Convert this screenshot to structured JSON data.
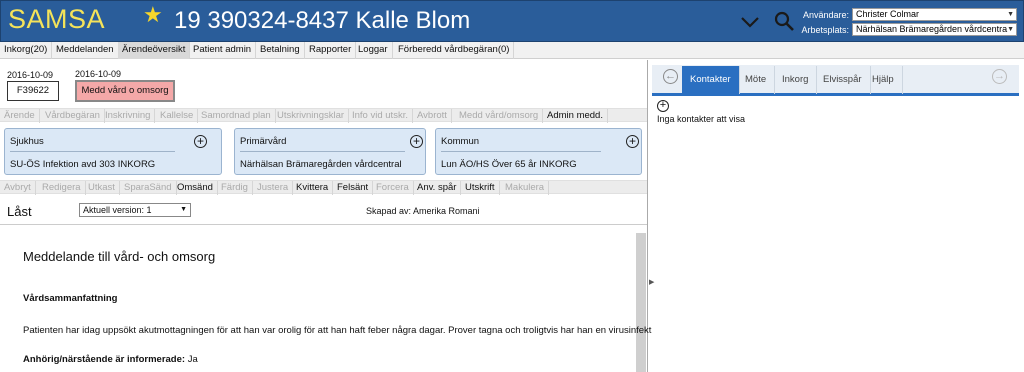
{
  "header": {
    "logo": "SAMSA",
    "patient": "19 390324-8437 Kalle Blom",
    "user_label": "Användare:",
    "user_value": "Christer Colmar",
    "workplace_label": "Arbetsplats:",
    "workplace_value": "Närhälsan Brämaregården vårdcentra",
    "colors": {
      "bar": "#2a5d9a",
      "logo": "#f4e35a",
      "star": "#f6d62a"
    },
    "icons": [
      "star-icon",
      "chevron-down-icon",
      "search-icon"
    ]
  },
  "menu": [
    "Inkorg(20)",
    "Meddelanden",
    "Ärendeöversikt",
    "Patient admin",
    "Betalning",
    "Rapporter",
    "Loggar",
    "Förberedd vårdbegäran(0)"
  ],
  "menu_active": "Ärendeöversikt",
  "case": {
    "date1": "2016-10-09",
    "date2": "2016-10-09",
    "id": "F39622",
    "status": "Medd vård o omsorg",
    "status_color": "#f4a8a8"
  },
  "toolbar1": [
    {
      "label": "Ärende",
      "enabled": false
    },
    {
      "label": "Vårdbegäran",
      "enabled": false
    },
    {
      "label": "Inskrivning",
      "enabled": false
    },
    {
      "label": "Kallelse",
      "enabled": false
    },
    {
      "label": "Samordnad plan",
      "enabled": false
    },
    {
      "label": "Utskrivningsklar",
      "enabled": false
    },
    {
      "label": "Info vid utskr.",
      "enabled": false
    },
    {
      "label": "Avbrott",
      "enabled": false
    },
    {
      "label": "Medd vård/omsorg",
      "enabled": false
    },
    {
      "label": "Admin medd.",
      "enabled": true
    }
  ],
  "cards": [
    {
      "title": "Sjukhus",
      "value": "SU-ÖS Infektion avd 303 INKORG"
    },
    {
      "title": "Primärvård",
      "value": "Närhälsan Brämaregården vårdcentral"
    },
    {
      "title": "Kommun",
      "value": "Lun ÄO/HS Över 65 år INKORG"
    }
  ],
  "toolbar2": [
    {
      "label": "Avbryt",
      "enabled": false
    },
    {
      "label": "Redigera",
      "enabled": false
    },
    {
      "label": "Utkast",
      "enabled": false
    },
    {
      "label": "SparaSänd",
      "enabled": false
    },
    {
      "label": "Omsänd",
      "enabled": true
    },
    {
      "label": "Färdig",
      "enabled": false
    },
    {
      "label": "Justera",
      "enabled": false
    },
    {
      "label": "Kvittera",
      "enabled": true
    },
    {
      "label": "Felsänt",
      "enabled": true
    },
    {
      "label": "Forcera",
      "enabled": false
    },
    {
      "label": "Anv. spår",
      "enabled": true
    },
    {
      "label": "Utskrift",
      "enabled": true
    },
    {
      "label": "Makulera",
      "enabled": false
    }
  ],
  "doc_header": {
    "state": "Låst",
    "version": "Aktuell version: 1",
    "created_by": "Skapad av: Amerika Romani"
  },
  "document": {
    "title": "Meddelande till vård- och omsorg",
    "section1_heading": "Vårdsammanfattning",
    "section1_text": "Patienten har idag uppsökt akutmottagningen för att han var orolig för att han haft feber några dagar. Prover tagna och troligtvis har han en virusinfektion.",
    "section2_heading": "Anhörig/närstående är informerade:",
    "section2_value": "Ja"
  },
  "right_panel": {
    "tabs": [
      "Kontakter",
      "Möte",
      "Inkorg",
      "Elvisspår",
      "Hjälp"
    ],
    "active_tab": "Kontakter",
    "empty_text": "Inga kontakter att visa",
    "accent": "#2a6fc1"
  }
}
